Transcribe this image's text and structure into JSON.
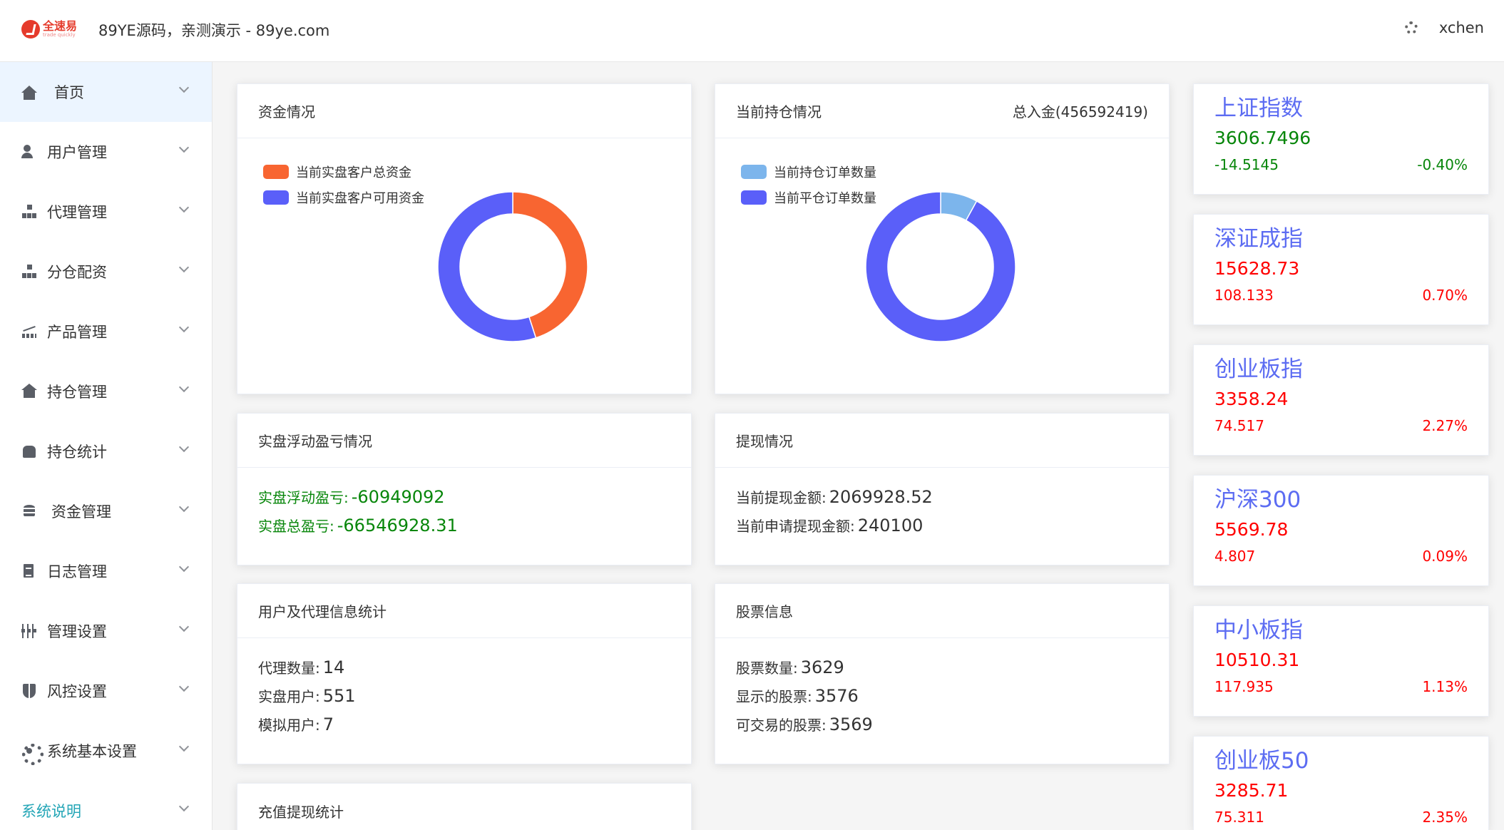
{
  "header": {
    "logo_text": "全速易",
    "logo_sub": "trade quickly",
    "title": "89YE源码，亲测演示 - 89ye.com",
    "username": "xchen"
  },
  "sidebar": {
    "items": [
      {
        "label": "首页",
        "icon": "home-icon"
      },
      {
        "label": "用户管理",
        "icon": "user-settings-icon"
      },
      {
        "label": "代理管理",
        "icon": "org-tree-icon"
      },
      {
        "label": "分仓配资",
        "icon": "org-tree-icon"
      },
      {
        "label": "产品管理",
        "icon": "chart-icon"
      },
      {
        "label": "持仓管理",
        "icon": "house-icon"
      },
      {
        "label": "持仓统计",
        "icon": "shirt-icon"
      },
      {
        "label": "资金管理",
        "icon": "coins-icon"
      },
      {
        "label": "日志管理",
        "icon": "document-icon"
      },
      {
        "label": "管理设置",
        "icon": "sliders-icon"
      },
      {
        "label": "风控设置",
        "icon": "shield-icon"
      },
      {
        "label": "系统基本设置",
        "icon": "gear-icon"
      },
      {
        "label": "系统说明",
        "icon": ""
      }
    ]
  },
  "funds": {
    "title": "资金情况",
    "legend": [
      "当前实盘客户总资金",
      "当前实盘客户可用资金"
    ],
    "colors": [
      "#f86531",
      "#5a5ff9"
    ]
  },
  "positions": {
    "title": "当前持仓情况",
    "total_label": "总入金(456592419)",
    "legend": [
      "当前持仓订单数量",
      "当前平仓订单数量"
    ],
    "colors": [
      "#7cb5ec",
      "#5a5ff9"
    ]
  },
  "floating": {
    "title": "实盘浮动盈亏情况",
    "rows": [
      {
        "label": "实盘浮动盈亏:",
        "value": "-60949092"
      },
      {
        "label": "实盘总盈亏:",
        "value": "-66546928.31"
      }
    ]
  },
  "withdraw": {
    "title": "提现情况",
    "rows": [
      {
        "label": "当前提现金额:",
        "value": "2069928.52"
      },
      {
        "label": "当前申请提现金额:",
        "value": "240100"
      }
    ]
  },
  "users": {
    "title": "用户及代理信息统计",
    "rows": [
      {
        "label": "代理数量:",
        "value": "14"
      },
      {
        "label": "实盘用户:",
        "value": "551"
      },
      {
        "label": "模拟用户:",
        "value": "7"
      }
    ]
  },
  "stocks": {
    "title": "股票信息",
    "rows": [
      {
        "label": "股票数量:",
        "value": "3629"
      },
      {
        "label": "显示的股票:",
        "value": "3576"
      },
      {
        "label": "可交易的股票:",
        "value": "3569"
      }
    ]
  },
  "recharge": {
    "title": "充值提现统计"
  },
  "indices": [
    {
      "name": "上证指数",
      "price": "3606.7496",
      "change": "-14.5145",
      "pct": "-0.40%",
      "trend": "down"
    },
    {
      "name": "深证成指",
      "price": "15628.73",
      "change": "108.133",
      "pct": "0.70%",
      "trend": "up"
    },
    {
      "name": "创业板指",
      "price": "3358.24",
      "change": "74.517",
      "pct": "2.27%",
      "trend": "up"
    },
    {
      "name": "沪深300",
      "price": "5569.78",
      "change": "4.807",
      "pct": "0.09%",
      "trend": "up"
    },
    {
      "name": "中小板指",
      "price": "10510.31",
      "change": "117.935",
      "pct": "1.13%",
      "trend": "up"
    },
    {
      "name": "创业板50",
      "price": "3285.71",
      "change": "75.311",
      "pct": "2.35%",
      "trend": "up"
    }
  ],
  "chart_data": [
    {
      "type": "pie",
      "legend": [
        "当前实盘客户总资金",
        "当前实盘客户可用资金"
      ],
      "values": [
        0.45,
        0.55
      ]
    },
    {
      "type": "pie",
      "legend": [
        "当前持仓订单数量",
        "当前平仓订单数量"
      ],
      "values": [
        0.08,
        0.92
      ]
    }
  ]
}
